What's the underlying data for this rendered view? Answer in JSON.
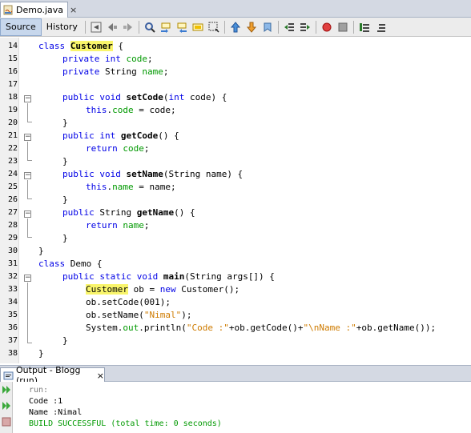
{
  "editor_tab": {
    "label": "Demo.java",
    "close": "×"
  },
  "toolbar": {
    "source_label": "Source",
    "history_label": "History"
  },
  "output_tab": {
    "label": "Output - Blogg (run)",
    "close": "×"
  },
  "output": {
    "run": "run:",
    "line1": "Code :1",
    "line2": "Name :Nimal",
    "build": "BUILD SUCCESSFUL (total time: 0 seconds)"
  },
  "line_numbers": [
    "14",
    "15",
    "16",
    "17",
    "18",
    "19",
    "20",
    "21",
    "22",
    "23",
    "24",
    "25",
    "26",
    "27",
    "28",
    "29",
    "30",
    "31",
    "32",
    "33",
    "34",
    "35",
    "36",
    "37",
    "38"
  ],
  "code": {
    "l14": {
      "kw": "class ",
      "name": "Customer",
      "rest": " {"
    },
    "l15": {
      "kw": "private int ",
      "fld": "code",
      "rest": ";"
    },
    "l16": {
      "kw": "private ",
      "type": "String ",
      "fld": "name",
      "rest": ";"
    },
    "l18": {
      "kw": "public void ",
      "name": "setCode",
      "a": "(",
      "kw2": "int",
      "b": " code) {"
    },
    "l19": {
      "kw": "this",
      "dot": ".",
      "fld": "code",
      "rest": " = code;"
    },
    "l20": "}",
    "l21": {
      "kw": "public int ",
      "name": "getCode",
      "rest": "() {"
    },
    "l22": {
      "kw": "return ",
      "fld": "code",
      "rest": ";"
    },
    "l23": "}",
    "l24": {
      "kw": "public void ",
      "name": "setName",
      "rest": "(String name) {"
    },
    "l25": {
      "kw": "this",
      "dot": ".",
      "fld": "name",
      "rest": " = name;"
    },
    "l26": "}",
    "l27": {
      "kw": "public ",
      "type": "String ",
      "name": "getName",
      "rest": "() {"
    },
    "l28": {
      "kw": "return ",
      "fld": "name",
      "rest": ";"
    },
    "l29": "}",
    "l30": "}",
    "l31": {
      "kw": "class ",
      "rest": "Demo {"
    },
    "l32": {
      "kw": "public static void ",
      "name": "main",
      "rest": "(String args[]) {"
    },
    "l33": {
      "name": "Customer",
      "a": " ob = ",
      "kw": "new",
      "b": " Customer();"
    },
    "l34": "ob.setCode(001);",
    "l35": {
      "a": "ob.setName(",
      "str": "\"Nimal\"",
      "b": ");"
    },
    "l36": {
      "a": "System.",
      "fld": "out",
      "b": ".println(",
      "s1": "\"Code :\"",
      "c": "+ob.getCode()+",
      "s2": "\"",
      "esc": "\\n",
      "s3": "Name :\"",
      "d": "+ob.getName());"
    },
    "l37": "}",
    "l38": "}"
  }
}
